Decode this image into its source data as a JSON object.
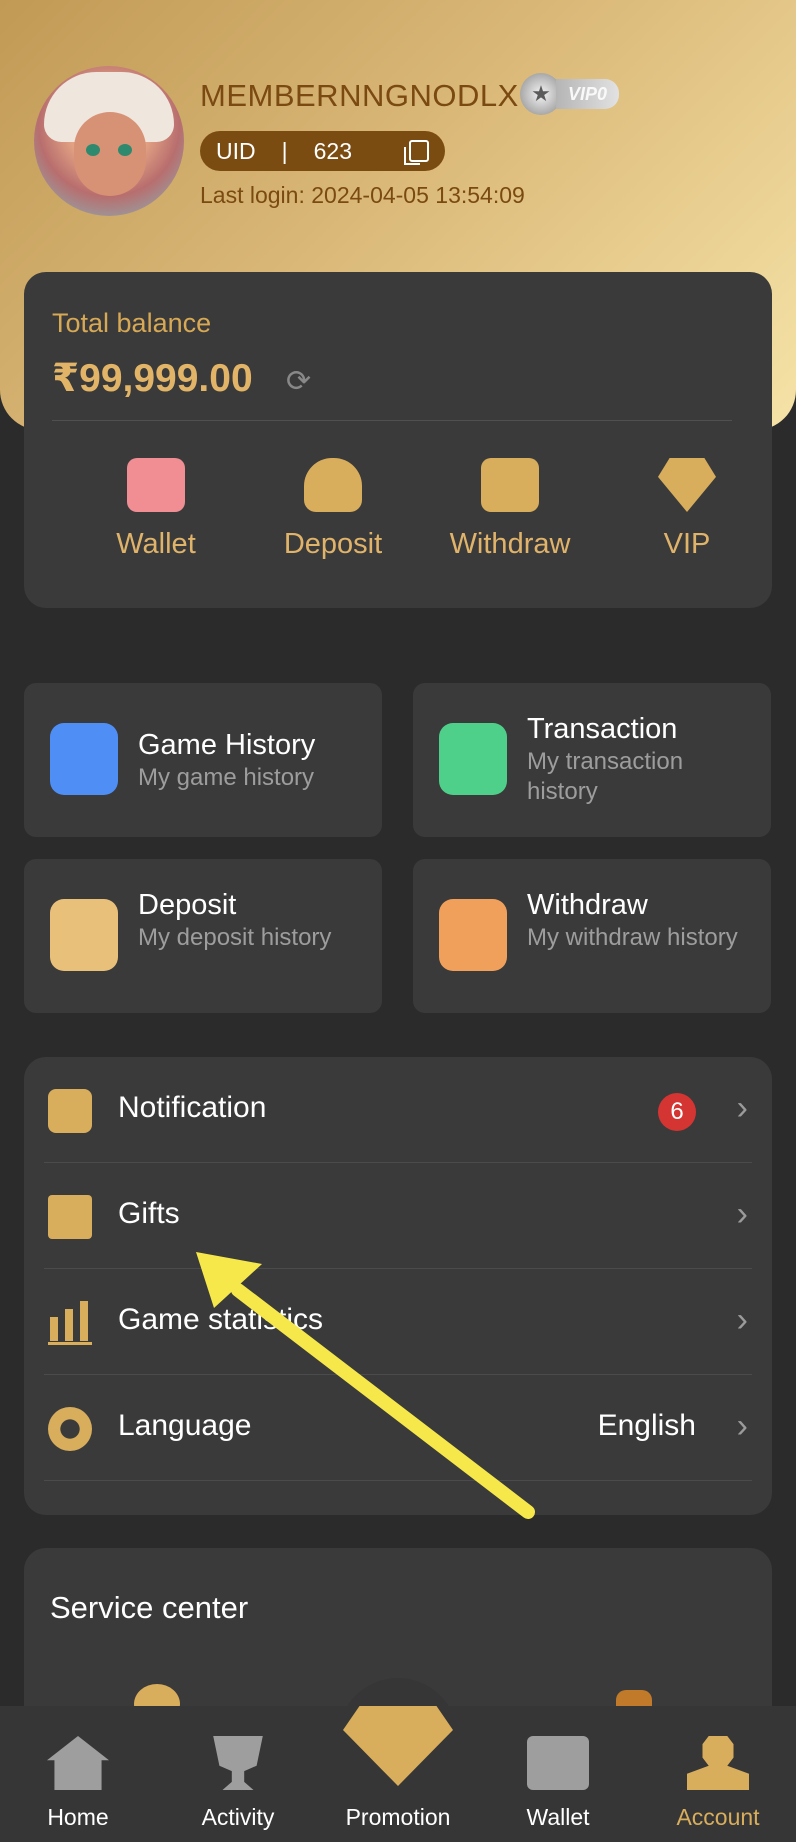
{
  "profile": {
    "username": "MEMBERNNGNODLX",
    "vip_label": "VIP0",
    "uid_label": "UID",
    "uid_separator": "|",
    "uid_value": "623",
    "last_login": "Last login: 2024-04-05 13:54:09"
  },
  "balance": {
    "label": "Total balance",
    "amount": "₹99,999.00"
  },
  "quick_actions": [
    {
      "label": "Wallet",
      "icon": "wallet-icon",
      "color": "#f08e94"
    },
    {
      "label": "Deposit",
      "icon": "deposit-bag-icon",
      "color": "#d8ad5c"
    },
    {
      "label": "Withdraw",
      "icon": "withdraw-card-icon",
      "color": "#d8ad5c"
    },
    {
      "label": "VIP",
      "icon": "vip-gem-icon",
      "color": "#d8ad5c"
    }
  ],
  "history_tiles": [
    {
      "title": "Game History",
      "subtitle": "My game history",
      "icon": "game-history-icon",
      "color": "#4f8ef5"
    },
    {
      "title": "Transaction",
      "subtitle": "My transaction history",
      "icon": "transaction-icon",
      "color": "#4fd08a"
    },
    {
      "title": "Deposit",
      "subtitle": "My deposit history",
      "icon": "deposit-history-icon",
      "color": "#e9c07a"
    },
    {
      "title": "Withdraw",
      "subtitle": "My withdraw history",
      "icon": "withdraw-history-icon",
      "color": "#f0a05a"
    }
  ],
  "menu": {
    "notification": {
      "label": "Notification",
      "badge": "6"
    },
    "gifts": {
      "label": "Gifts"
    },
    "game_statistics": {
      "label": "Game statistics"
    },
    "language": {
      "label": "Language",
      "value": "English"
    }
  },
  "service_center": {
    "title": "Service center"
  },
  "bottom_nav": [
    {
      "label": "Home",
      "icon": "home-icon",
      "active": false
    },
    {
      "label": "Activity",
      "icon": "trophy-icon",
      "active": false
    },
    {
      "label": "Promotion",
      "icon": "promotion-diamond-icon",
      "active": false
    },
    {
      "label": "Wallet",
      "icon": "wallet-nav-icon",
      "active": false
    },
    {
      "label": "Account",
      "icon": "account-icon",
      "active": true
    }
  ],
  "colors": {
    "accent_gold": "#d8ad5c",
    "card_bg": "#3a3a3a",
    "page_bg": "#2b2b2b",
    "badge_red": "#d43532",
    "annotation_arrow": "#f6e84a"
  }
}
